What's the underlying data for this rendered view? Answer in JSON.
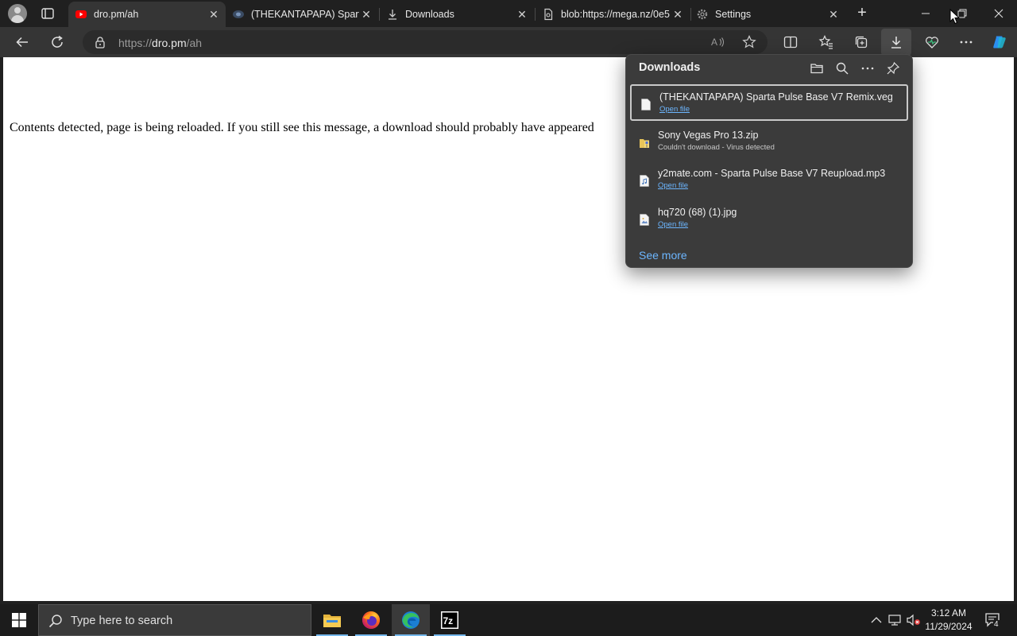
{
  "tabs": [
    {
      "title": "dro.pm/ah",
      "favicon": "youtube-icon",
      "active": true
    },
    {
      "title": "(THEKANTAPAPA) Sparta",
      "favicon": "site-icon",
      "active": false
    },
    {
      "title": "Downloads",
      "favicon": "download-icon",
      "active": false
    },
    {
      "title": "blob:https://mega.nz/0e5",
      "favicon": "document-icon",
      "active": false
    },
    {
      "title": "Settings",
      "favicon": "gear-icon",
      "active": false
    }
  ],
  "address": {
    "scheme": "https://",
    "host": "dro.pm",
    "path": "/ah"
  },
  "page": {
    "message": "Contents detected, page is being reloaded. If you still see this message, a download should probably have appeared"
  },
  "downloads": {
    "title": "Downloads",
    "items": [
      {
        "name": "(THEKANTAPAPA) Sparta Pulse Base V7 Remix.veg",
        "status": "Open file",
        "error": false,
        "icon": "file-icon"
      },
      {
        "name": "Sony Vegas Pro 13.zip",
        "status": "Couldn't download - Virus detected",
        "error": true,
        "icon": "zip-folder-icon"
      },
      {
        "name": "y2mate.com - Sparta Pulse Base V7 Reupload.mp3",
        "status": "Open file",
        "error": false,
        "icon": "audio-file-icon"
      },
      {
        "name": "hq720 (68) (1).jpg",
        "status": "Open file",
        "error": false,
        "icon": "image-file-icon"
      }
    ],
    "see_more": "See more"
  },
  "taskbar": {
    "search_placeholder": "Type here to search",
    "apps": [
      "file-explorer-icon",
      "firefox-icon",
      "edge-icon",
      "7zip-icon"
    ],
    "time": "3:12 AM",
    "date": "11/29/2024",
    "notification_count": "4"
  },
  "colors": {
    "accent": "#6cb6ff",
    "youtube": "#ff0000",
    "edge_blue": "#1b7fd4"
  }
}
